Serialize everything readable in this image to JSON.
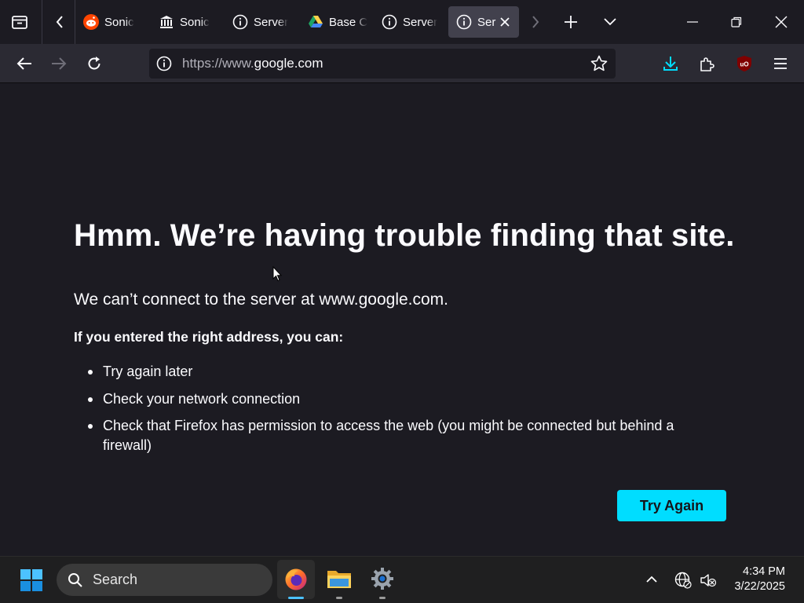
{
  "browser": {
    "tabs": [
      {
        "label": "Sonic",
        "icon": "reddit-icon",
        "active": false
      },
      {
        "label": "Sonic",
        "icon": "museum-icon",
        "active": false
      },
      {
        "label": "Server",
        "icon": "info-icon",
        "active": false
      },
      {
        "label": "Base C",
        "icon": "google-drive-icon",
        "active": false
      },
      {
        "label": "Server",
        "icon": "info-icon",
        "active": false
      },
      {
        "label": "Ser",
        "icon": "info-icon",
        "active": true
      }
    ],
    "address_bar": {
      "url_prefix": "https://www.",
      "url_host": "google.com"
    }
  },
  "error_page": {
    "title": "Hmm. We’re having trouble finding that site.",
    "subtitle": "We can’t connect to the server at www.google.com.",
    "lead": "If you entered the right address, you can:",
    "suggestions": [
      "Try again later",
      "Check your network connection",
      "Check that Firefox has permission to access the web (you might be connected but behind a firewall)"
    ],
    "retry_button": "Try Again"
  },
  "taskbar": {
    "search_placeholder": "Search",
    "time": "4:34 PM",
    "date": "3/22/2025"
  },
  "colors": {
    "accent": "#00ddff",
    "page_background": "#1c1b22",
    "toolbar_background": "#2b2a33",
    "active_tab": "#42414d",
    "ublock_red": "#800000"
  }
}
